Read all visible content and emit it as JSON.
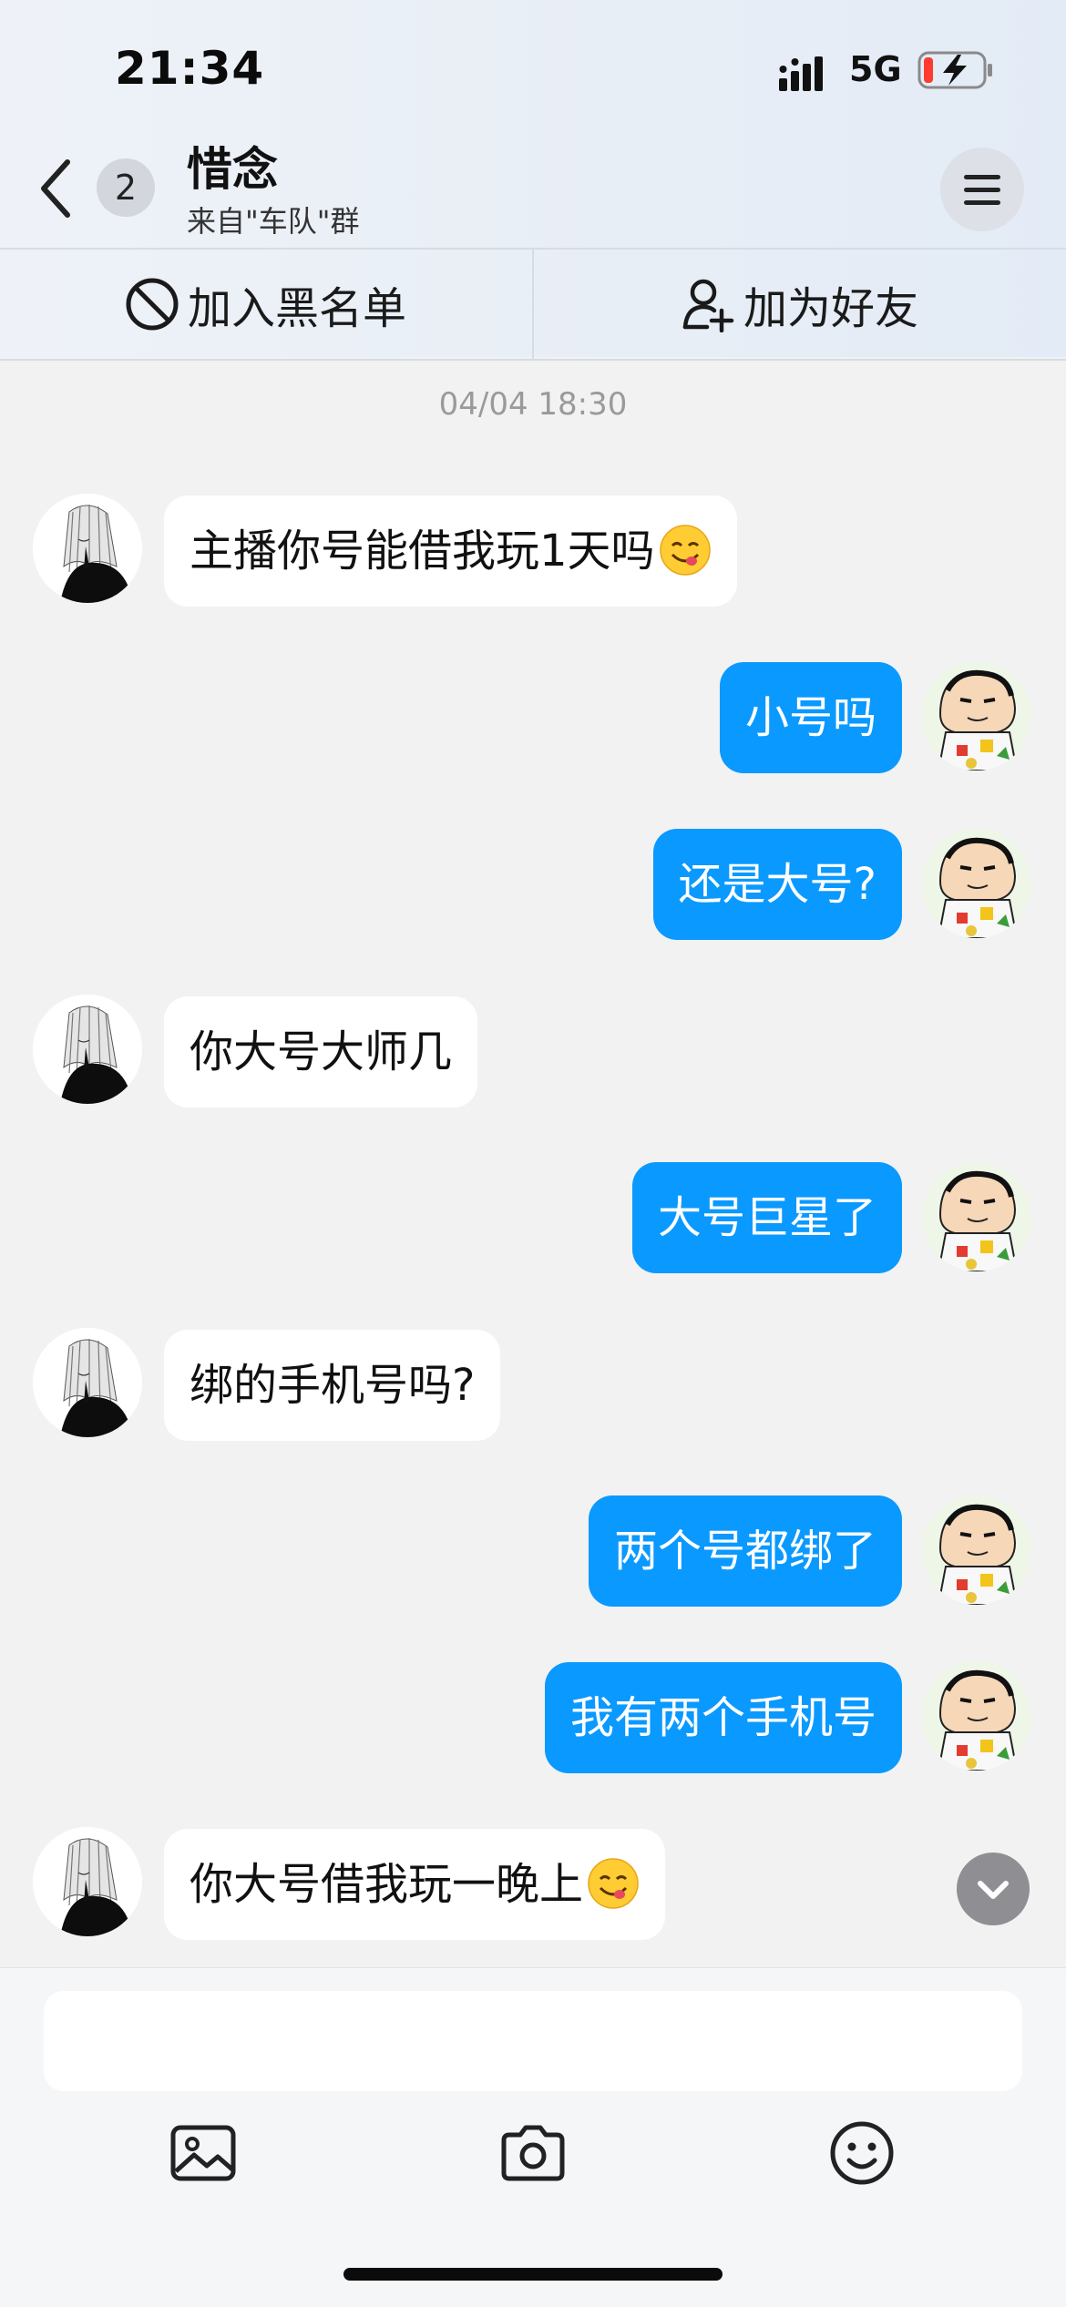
{
  "status_bar": {
    "time": "21:34",
    "network": "5G"
  },
  "header": {
    "unread_count": "2",
    "contact_name": "惜念",
    "source": "来自\"车队\"群"
  },
  "actions": {
    "blacklist": "加入黑名单",
    "add_friend": "加为好友"
  },
  "chat": {
    "timestamp": "04/04 18:30",
    "messages": [
      {
        "from": "other",
        "text": "主播你号能借我玩1天吗",
        "emoji": "yum-face"
      },
      {
        "from": "me",
        "text": "小号吗"
      },
      {
        "from": "me",
        "text": "还是大号?"
      },
      {
        "from": "other",
        "text": "你大号大师几"
      },
      {
        "from": "me",
        "text": "大号巨星了"
      },
      {
        "from": "other",
        "text": "绑的手机号吗?"
      },
      {
        "from": "me",
        "text": "两个号都绑了"
      },
      {
        "from": "me",
        "text": "我有两个手机号"
      },
      {
        "from": "other",
        "text": "你大号借我玩一晚上",
        "emoji": "yum-face"
      }
    ]
  },
  "composer": {
    "placeholder": ""
  },
  "colors": {
    "outgoing_bubble": "#0a99ff",
    "incoming_bubble": "#ffffff",
    "background": "#f2f2f2"
  }
}
